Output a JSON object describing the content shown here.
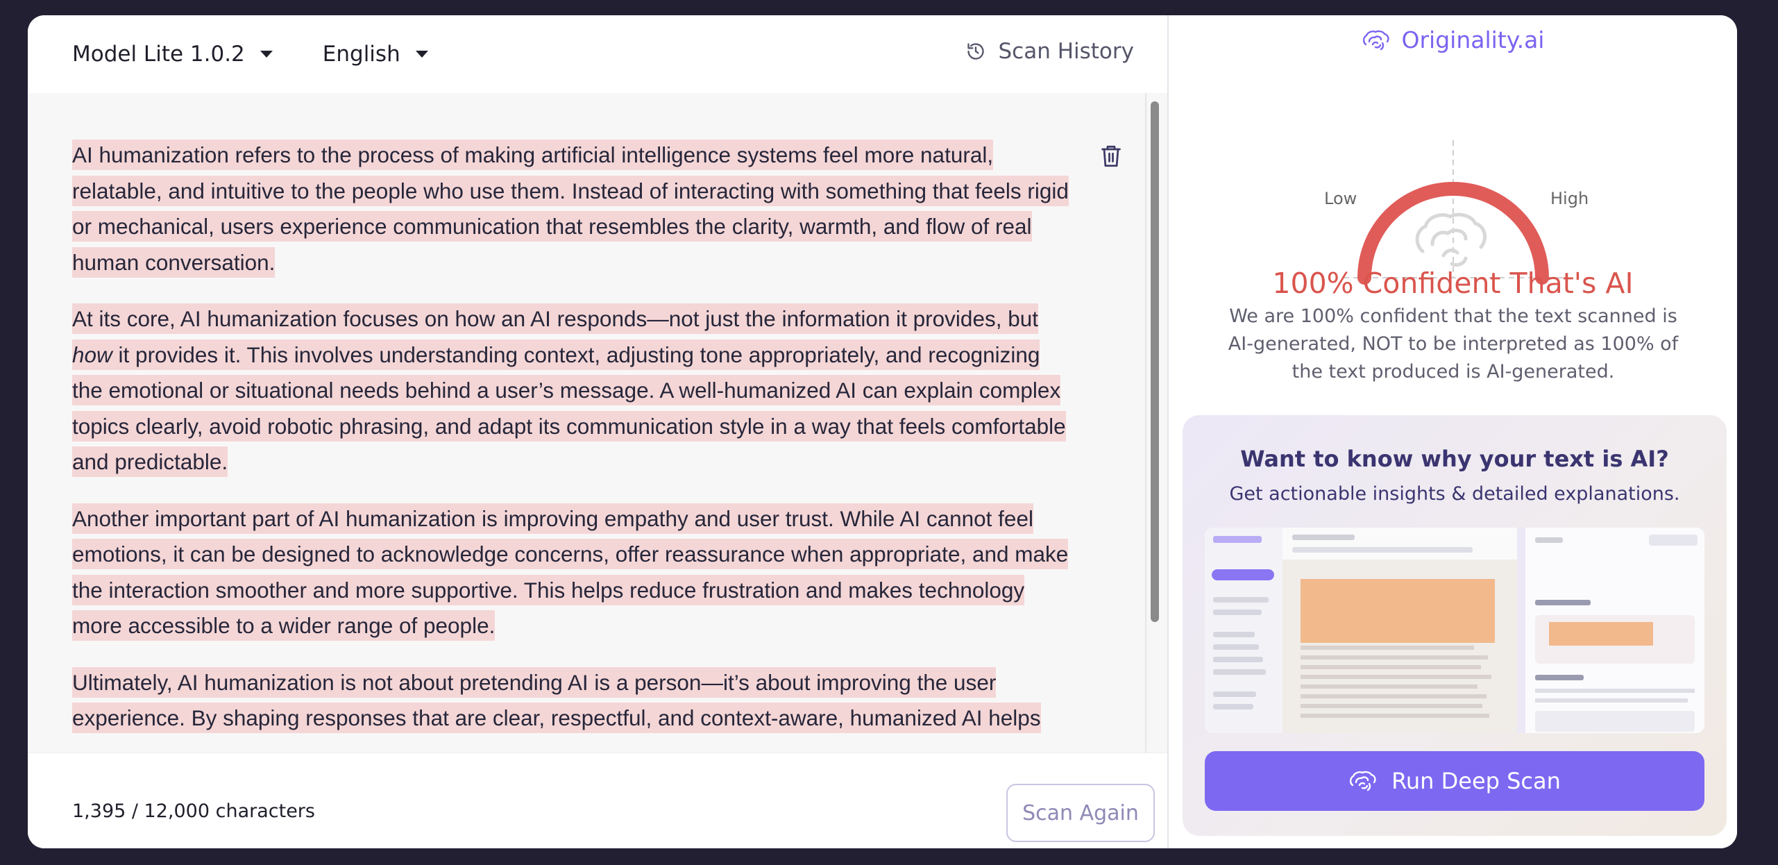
{
  "toolbar": {
    "model_label": "Model Lite 1.0.2",
    "language_label": "English",
    "history_label": "Scan History"
  },
  "editor": {
    "paragraphs": {
      "p1": "AI humanization refers to the process of making artificial intelligence systems feel more natural, relatable, and intuitive to the people who use them. Instead of interacting with something that feels rigid or mechanical, users experience communication that resembles the clarity, warmth, and flow of real human conversation.",
      "p2a": "At its core, AI humanization focuses on how an AI responds—not just the information it provides, but ",
      "p2_italic": "how",
      "p2b": " it provides it. This involves understanding context, adjusting tone appropriately, and recognizing the emotional or situational needs behind a user’s message. A well-humanized AI can explain complex topics clearly, avoid robotic phrasing, and adapt its communication style in a way that feels comfortable and predictable.",
      "p3": "Another important part of AI humanization is improving empathy and user trust. While AI cannot feel emotions, it can be designed to acknowledge concerns, offer reassurance when appropriate, and make the interaction smoother and more supportive. This helps reduce frustration and makes technology more accessible to a wider range of people.",
      "p4": "Ultimately, AI humanization is not about pretending AI is a person—it’s about improving the user experience. By shaping responses that are clear, respectful, and context-aware, humanized AI helps"
    },
    "highlight_color": "#f4d6d6"
  },
  "footer": {
    "char_count": "1,395 / 12,000 characters",
    "scan_again_label": "Scan Again"
  },
  "results": {
    "brand": "Originality.ai",
    "gauge": {
      "low_label": "Low",
      "high_label": "High",
      "value": 100
    },
    "headline": "100% Confident That's AI",
    "description": "We are 100% confident that the text scanned is AI-generated, NOT to be interpreted as 100% of the text produced is AI-generated."
  },
  "promo": {
    "title": "Want to know why your text is AI?",
    "subtitle": "Get actionable insights & detailed explanations.",
    "button_label": "Run Deep Scan"
  },
  "colors": {
    "accent": "#7d68f2",
    "danger": "#d9554d",
    "background": "#231f33"
  }
}
